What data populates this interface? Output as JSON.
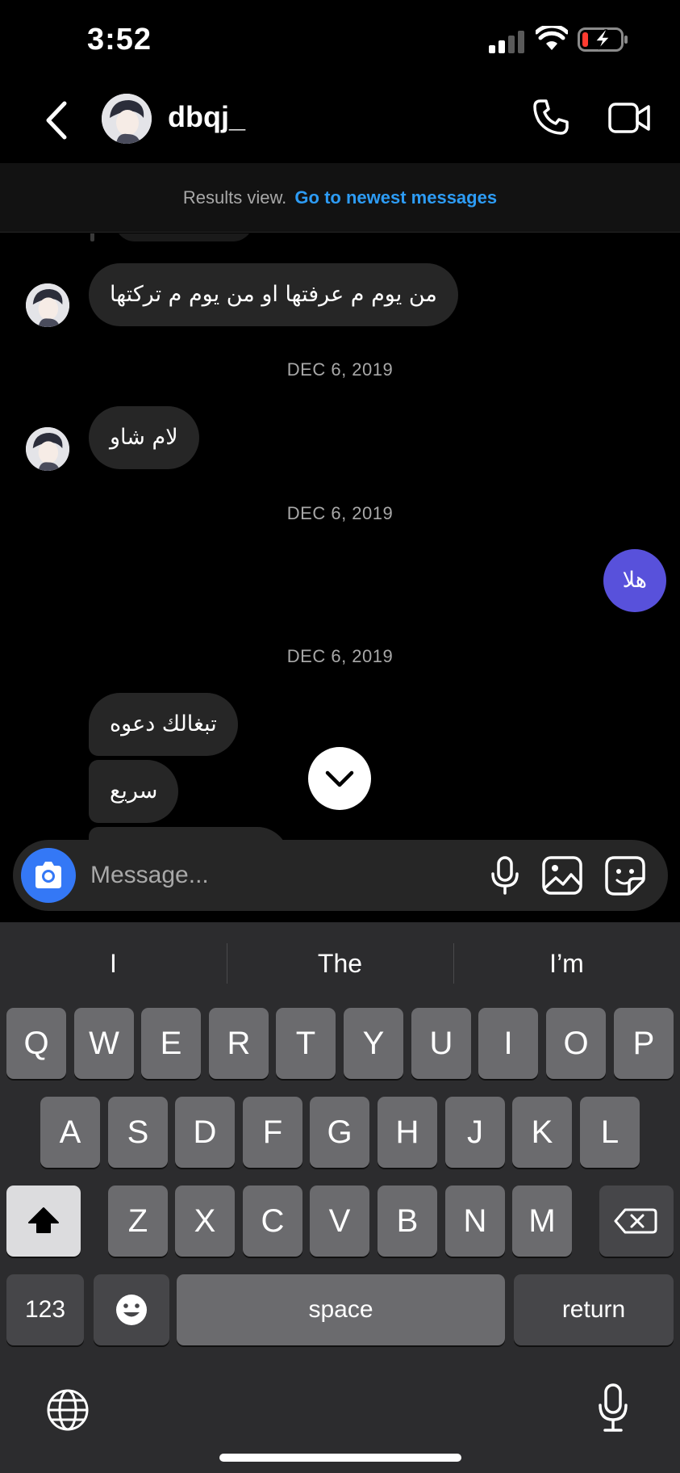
{
  "status_bar": {
    "time": "3:52"
  },
  "header": {
    "username": "dbqj_"
  },
  "results_banner": {
    "text": "Results view.",
    "link": "Go to newest messages"
  },
  "messages": [
    {
      "type": "received",
      "text": "من يوم م عرفتها او من يوم م تركتها"
    },
    {
      "type": "date",
      "text": "DEC 6, 2019"
    },
    {
      "type": "received",
      "text": "لام شاو"
    },
    {
      "type": "date",
      "text": "DEC 6, 2019"
    },
    {
      "type": "sent",
      "text": "هلا"
    },
    {
      "type": "date",
      "text": "DEC 6, 2019"
    },
    {
      "type": "received",
      "text": "تبغالك دعوه"
    },
    {
      "type": "received",
      "text": "سريع"
    }
  ],
  "composer": {
    "placeholder": "Message..."
  },
  "keyboard": {
    "suggestions": [
      "I",
      "The",
      "I’m"
    ],
    "row1": [
      "Q",
      "W",
      "E",
      "R",
      "T",
      "Y",
      "U",
      "I",
      "O",
      "P"
    ],
    "row2": [
      "A",
      "S",
      "D",
      "F",
      "G",
      "H",
      "J",
      "K",
      "L"
    ],
    "row3": [
      "Z",
      "X",
      "C",
      "V",
      "B",
      "N",
      "M"
    ],
    "numbers_label": "123",
    "space_label": "space",
    "return_label": "return"
  },
  "colors": {
    "accent_link": "#2d9cf5",
    "sent_bubble": "#5851db",
    "camera_button": "#3478f6"
  }
}
